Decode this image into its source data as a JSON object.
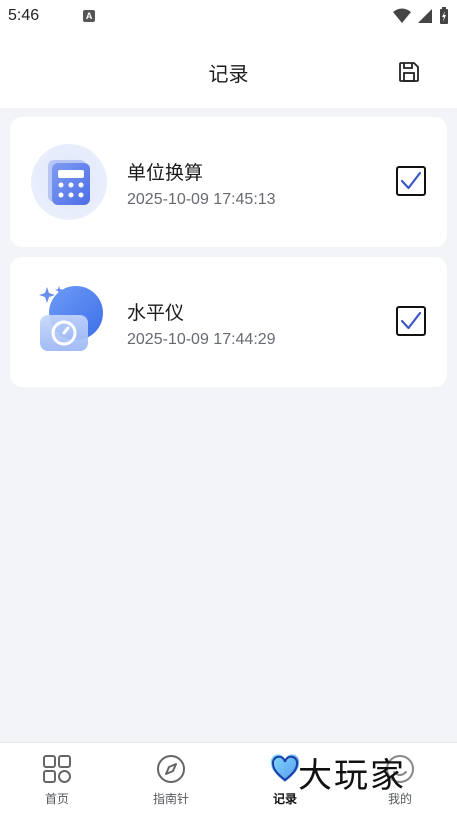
{
  "status_bar": {
    "time": "5:46",
    "notification_badge": "A"
  },
  "header": {
    "title": "记录",
    "save_icon": "save-icon"
  },
  "records": [
    {
      "name": "单位换算",
      "time": "2025-10-09 17:45:13",
      "icon": "calculator-icon",
      "checked": true
    },
    {
      "name": "水平仪",
      "time": "2025-10-09 17:44:29",
      "icon": "level-icon",
      "checked": true
    }
  ],
  "nav": [
    {
      "label": "首页",
      "icon": "grid-icon",
      "active": false
    },
    {
      "label": "指南针",
      "icon": "compass-icon",
      "active": false
    },
    {
      "label": "记录",
      "icon": "heart-icon",
      "active": true
    },
    {
      "label": "我的",
      "icon": "profile-icon",
      "active": false
    }
  ],
  "watermark": "大玩家",
  "colors": {
    "accent": "#4a7cf0",
    "check": "#3b57c4",
    "background": "#f3f4f7"
  }
}
